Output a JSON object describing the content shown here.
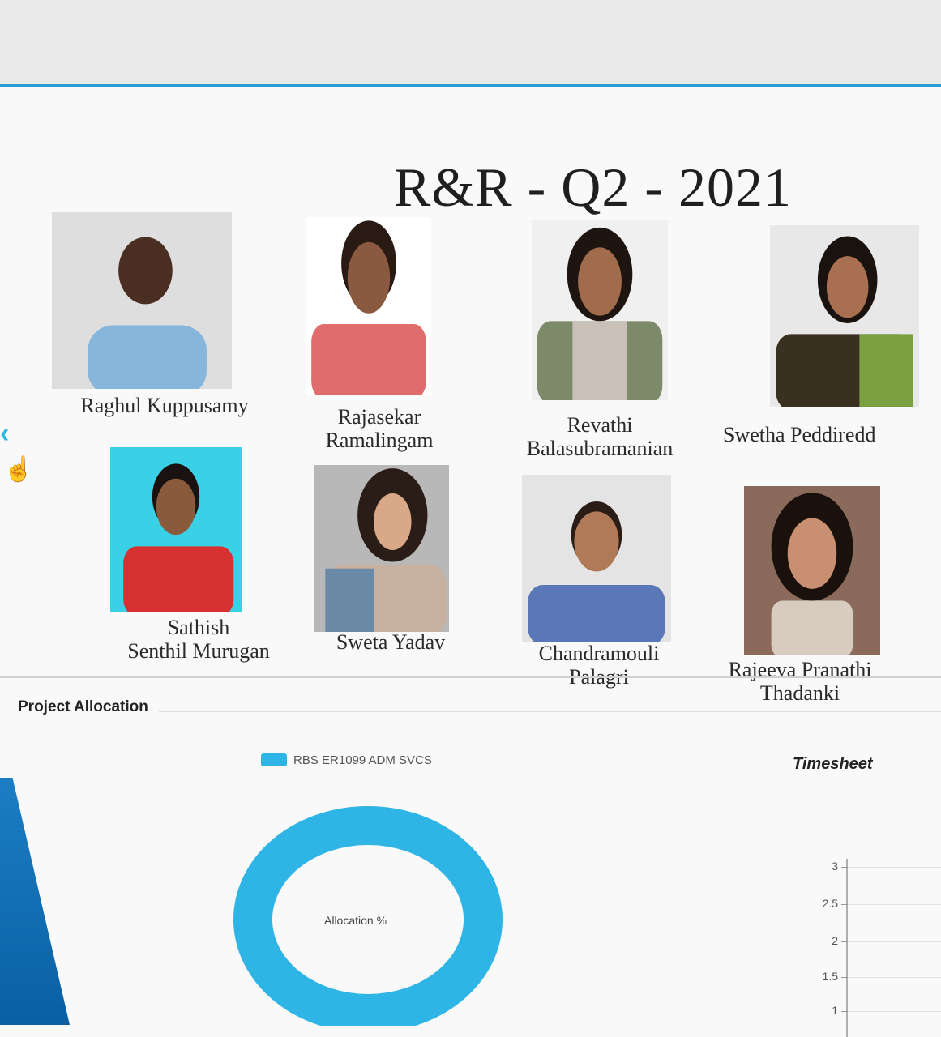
{
  "banner": {
    "title": "R&R - Q2 - 2021"
  },
  "people": [
    {
      "line1": "Raghul Kuppusamy",
      "line2": ""
    },
    {
      "line1": "Rajasekar",
      "line2": "Ramalingam"
    },
    {
      "line1": "Revathi",
      "line2": "Balasubramanian"
    },
    {
      "line1": "Swetha Peddiredd",
      "line2": ""
    },
    {
      "line1": "Sathish",
      "line2": "Senthil Murugan"
    },
    {
      "line1": "Sweta Yadav",
      "line2": ""
    },
    {
      "line1": "Chandramouli",
      "line2": "Palagri"
    },
    {
      "line1": "Rajeeva Pranathi",
      "line2": "Thadanki"
    }
  ],
  "carousel": {
    "prev_icon": "chevron-left-icon",
    "cursor_icon": "hand-pointer-icon"
  },
  "project_allocation": {
    "title": "Project Allocation",
    "legend_label": "RBS ER1099 ADM SVCS",
    "center_label": "Allocation %",
    "color": "#2fb4e6"
  },
  "timesheet": {
    "title": "Timesheet",
    "ticks": [
      "3",
      "2.5",
      "2",
      "1.5",
      "1"
    ]
  },
  "colors": {
    "accent": "#2a9fd6",
    "donut": "#2fb4e6"
  }
}
